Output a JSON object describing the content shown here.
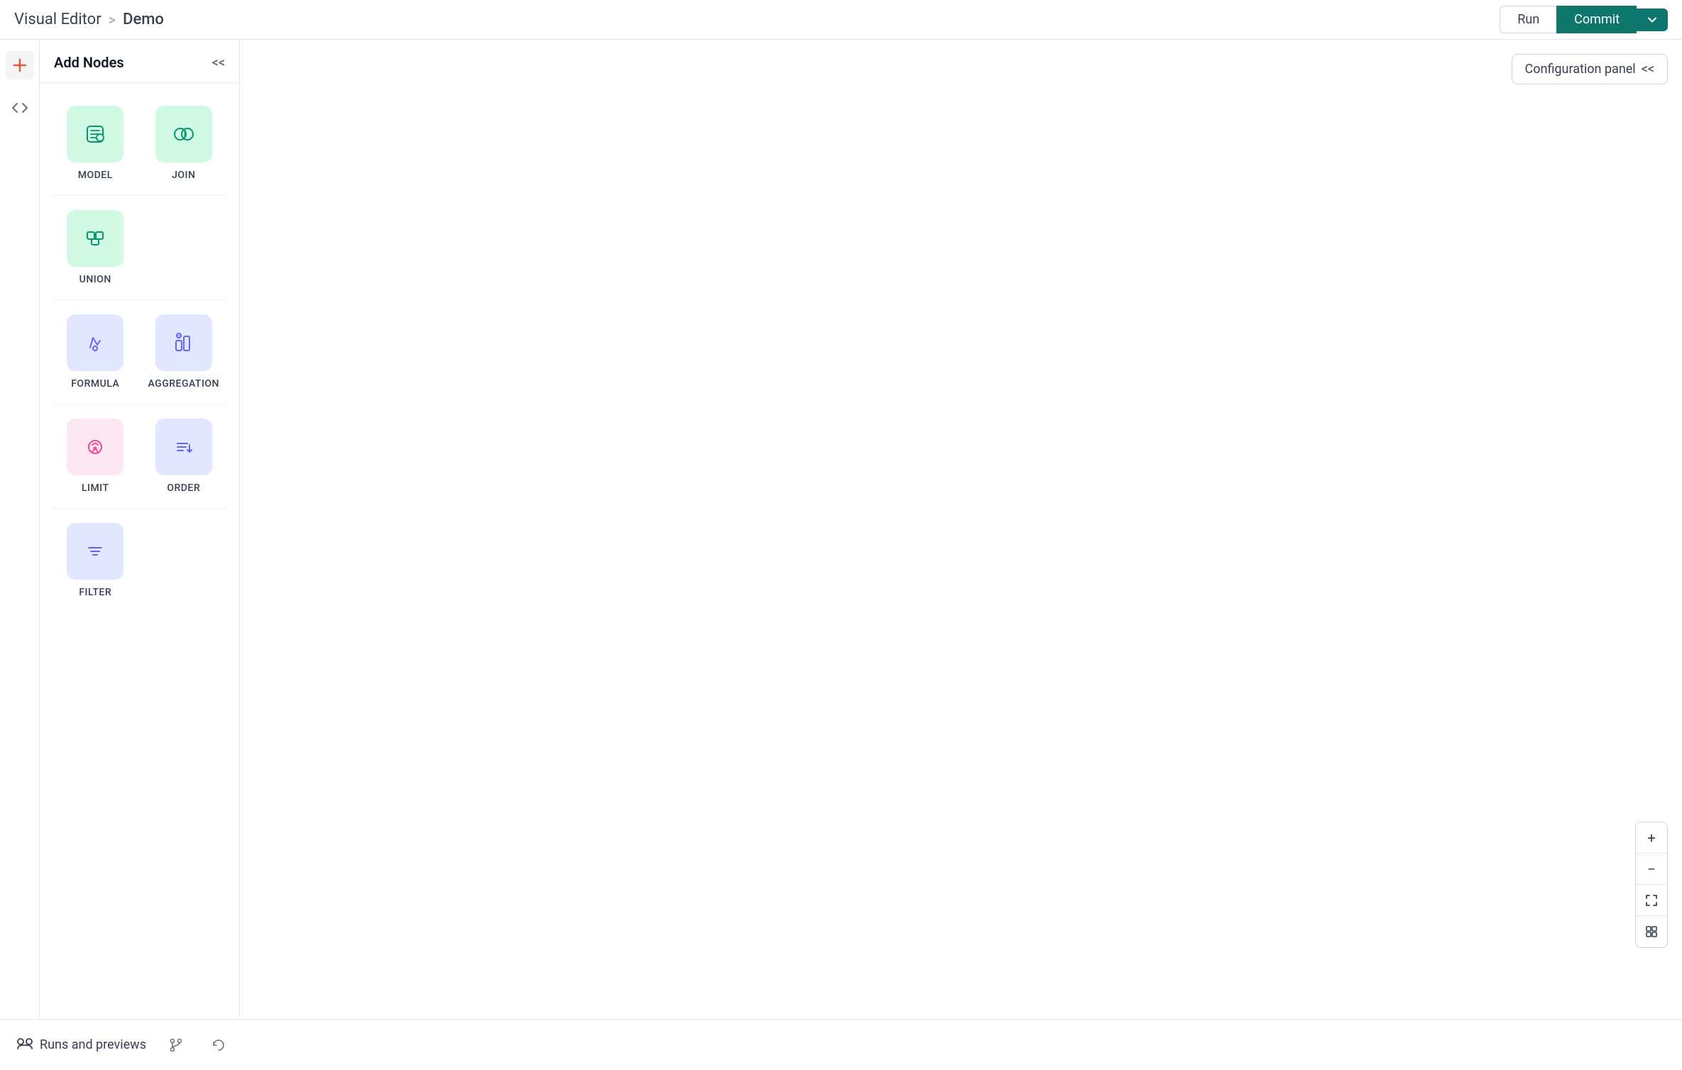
{
  "header": {
    "breadcrumb_app": "Visual Editor",
    "breadcrumb_separator": ">",
    "breadcrumb_project": "Demo",
    "btn_run": "Run",
    "btn_commit": "Commit",
    "btn_dropdown_aria": "dropdown",
    "config_panel_label": "Configuration panel",
    "config_panel_collapse": "<<"
  },
  "left_sidebar": {
    "add_icon": "+",
    "code_icon": "</>"
  },
  "add_nodes_panel": {
    "title": "Add Nodes",
    "collapse": "<<",
    "nodes": [
      {
        "id": "model",
        "label": "MODEL",
        "color": "green",
        "icon": "model"
      },
      {
        "id": "join",
        "label": "JOIN",
        "color": "green",
        "icon": "join"
      },
      {
        "id": "union",
        "label": "UNION",
        "color": "green",
        "icon": "union"
      },
      {
        "id": "formula",
        "label": "FORMULA",
        "color": "purple",
        "icon": "formula"
      },
      {
        "id": "aggregation",
        "label": "AGGREGATION",
        "color": "purple",
        "icon": "aggregation"
      },
      {
        "id": "limit",
        "label": "LIMIT",
        "color": "pink",
        "icon": "limit"
      },
      {
        "id": "order",
        "label": "ORDER",
        "color": "purple",
        "icon": "order"
      },
      {
        "id": "filter",
        "label": "FILTER",
        "color": "purple",
        "icon": "filter"
      }
    ]
  },
  "zoom_controls": {
    "zoom_in": "+",
    "zoom_out": "−",
    "fit": "fit",
    "grid": "grid"
  },
  "bottom_bar": {
    "runs_previews_label": "Runs and previews",
    "icon1": "git-branch",
    "icon2": "refresh"
  }
}
